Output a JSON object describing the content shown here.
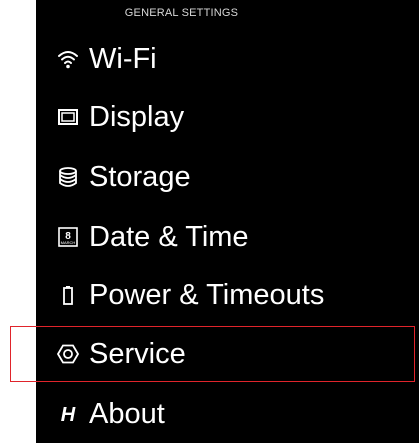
{
  "header": {
    "title": "GENERAL SETTINGS"
  },
  "menu": {
    "items": [
      {
        "label": "Wi-Fi",
        "icon": "wifi-icon"
      },
      {
        "label": "Display",
        "icon": "display-icon"
      },
      {
        "label": "Storage",
        "icon": "storage-icon"
      },
      {
        "label": "Date & Time",
        "icon": "calendar-icon",
        "icon_text": {
          "day": "8",
          "month": "MARCH"
        }
      },
      {
        "label": "Power & Timeouts",
        "icon": "battery-icon"
      },
      {
        "label": "Service",
        "icon": "service-icon",
        "highlighted": true
      },
      {
        "label": "About",
        "icon": "hasselblad-logo-icon",
        "icon_text": "H"
      }
    ]
  },
  "colors": {
    "background": "#000000",
    "text": "#ffffff",
    "highlight_border": "#e0242b"
  }
}
